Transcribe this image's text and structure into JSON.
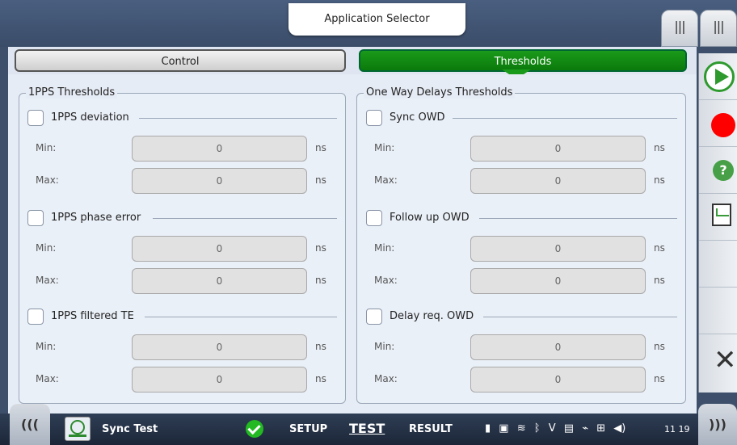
{
  "header": {
    "app_selector_label": "Application Selector",
    "right_tab_1": "|||",
    "right_tab_2": "|||"
  },
  "tabs": [
    {
      "label": "Control",
      "active": false
    },
    {
      "label": "Thresholds",
      "active": true
    }
  ],
  "left_group": {
    "title": "1PPS Thresholds",
    "sections": [
      {
        "label": "1PPS deviation",
        "checked": false,
        "min": "0",
        "max": "0"
      },
      {
        "label": "1PPS phase error",
        "checked": false,
        "min": "0",
        "max": "0"
      },
      {
        "label": "1PPS filtered TE",
        "checked": false,
        "min": "0",
        "max": "0"
      }
    ]
  },
  "right_group": {
    "title": "One Way Delays Thresholds",
    "sections": [
      {
        "label": "Sync OWD",
        "checked": false,
        "min": "0",
        "max": "0"
      },
      {
        "label": "Follow up OWD",
        "checked": false,
        "min": "0",
        "max": "0"
      },
      {
        "label": "Delay req. OWD",
        "checked": false,
        "min": "0",
        "max": "0"
      }
    ]
  },
  "labels": {
    "min": "Min:",
    "max": "Max:",
    "unit": "ns"
  },
  "sidebar": {
    "buttons": [
      "play-icon",
      "record-icon",
      "help-icon",
      "report-icon",
      "",
      "",
      "close-icon"
    ]
  },
  "bottombar": {
    "left_nav": "(((",
    "right_nav": ")))",
    "test_name": "Sync Test",
    "setup": "SETUP",
    "test": "TEST",
    "result": "RESULT",
    "status_v": "V",
    "time": "11 19"
  },
  "colors": {
    "active_tab": "#0b7a0b",
    "record": "#ff0000",
    "play": "#2e9a2e"
  }
}
